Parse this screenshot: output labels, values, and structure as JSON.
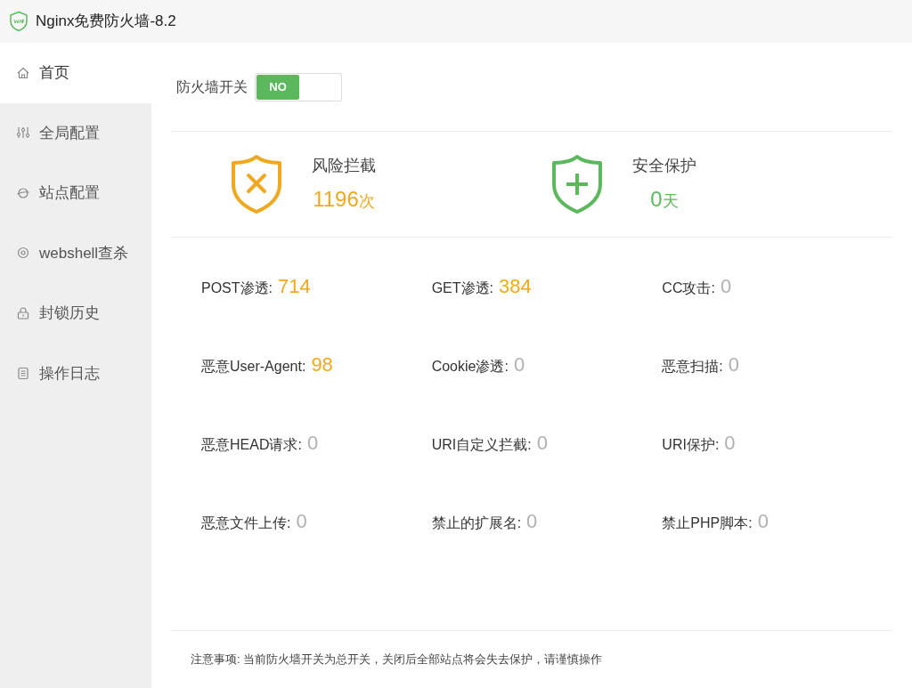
{
  "window": {
    "title": "Nginx免费防火墙-8.2"
  },
  "sidebar": {
    "items": [
      {
        "label": "首页",
        "kind": "home",
        "selected": true
      },
      {
        "label": "全局配置",
        "kind": "sliders",
        "selected": false
      },
      {
        "label": "站点配置",
        "kind": "planet",
        "selected": false
      },
      {
        "label": "webshell查杀",
        "kind": "target",
        "selected": false
      },
      {
        "label": "封锁历史",
        "kind": "lock",
        "selected": false
      },
      {
        "label": "操作日志",
        "kind": "clipboard",
        "selected": false
      }
    ]
  },
  "firewall_switch": {
    "label": "防火墙开关",
    "on": true,
    "text": "NO"
  },
  "summary": [
    {
      "kind": "risk",
      "title": "风险拦截",
      "value": "1196",
      "unit": "次",
      "color": "#f0a820"
    },
    {
      "kind": "safe",
      "title": "安全保护",
      "value": "0",
      "unit": "天",
      "color": "#5cb85c"
    }
  ],
  "stats": [
    {
      "label": "POST渗透:",
      "value": "714",
      "color": "#f0a820"
    },
    {
      "label": "GET渗透:",
      "value": "384",
      "color": "#f0a820"
    },
    {
      "label": "CC攻击:",
      "value": "0",
      "color": "#b0b0b0"
    },
    {
      "label": "恶意User-Agent:",
      "value": "98",
      "color": "#f0a820"
    },
    {
      "label": "Cookie渗透:",
      "value": "0",
      "color": "#b0b0b0"
    },
    {
      "label": "恶意扫描:",
      "value": "0",
      "color": "#b0b0b0"
    },
    {
      "label": "恶意HEAD请求:",
      "value": "0",
      "color": "#b0b0b0"
    },
    {
      "label": "URI自定义拦截:",
      "value": "0",
      "color": "#b0b0b0"
    },
    {
      "label": "URI保护:",
      "value": "0",
      "color": "#b0b0b0"
    },
    {
      "label": "恶意文件上传:",
      "value": "0",
      "color": "#b0b0b0"
    },
    {
      "label": "禁止的扩展名:",
      "value": "0",
      "color": "#b0b0b0"
    },
    {
      "label": "禁止PHP脚本:",
      "value": "0",
      "color": "#b0b0b0"
    }
  ],
  "notice": "注意事项: 当前防火墙开关为总开关，关闭后全部站点将会失去保护，请谨慎操作"
}
